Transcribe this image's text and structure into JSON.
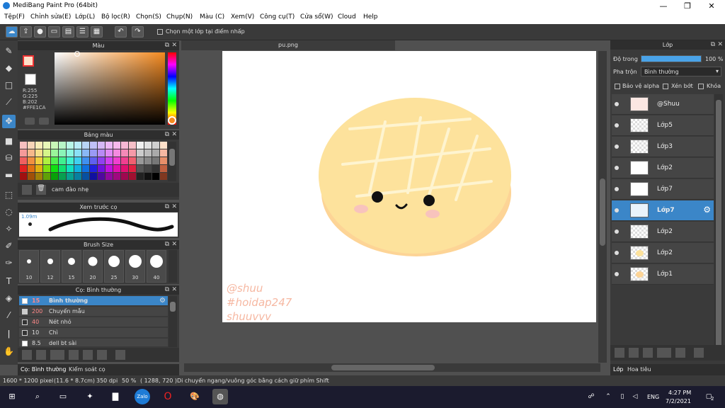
{
  "window": {
    "title": "MediBang Paint Pro (64bit)",
    "minimize": "—",
    "maximize": "❐",
    "close": "✕"
  },
  "menu": [
    "Tệp(F)",
    "Chỉnh sửa(E)",
    "Lớp(L)",
    "Bộ lọc(R)",
    "Chọn(S)",
    "Chụp(N)",
    "Màu (C)",
    "Xem(V)",
    "Công cụ(T)",
    "Cửa sổ(W)",
    "Cloud",
    "Help"
  ],
  "toolbar": {
    "checkbox_label": "Chọn một lớp tại điểm nhấp"
  },
  "color_panel": {
    "title": "Màu",
    "r": "R:255",
    "g": "G:225",
    "b": "B:202",
    "hex": "#FFE1CA",
    "fg": "#ffe1ca"
  },
  "palette_panel": {
    "title": "Bảng màu",
    "palette_name": "cam đào nhẹ"
  },
  "brush_preview": {
    "title": "Xem trước cọ",
    "size_label": "1.09m"
  },
  "brush_size": {
    "title": "Brush Size",
    "sizes": [
      "10",
      "12",
      "15",
      "20",
      "25",
      "30",
      "40"
    ]
  },
  "brush_list": {
    "title": "Cọ: Bình thường",
    "items": [
      {
        "size": "15",
        "name": "Bình thường",
        "color": "#ffffff"
      },
      {
        "size": "200",
        "name": "Chuyển mẫu",
        "color": "#cccccc"
      },
      {
        "size": "40",
        "name": "Nét nhỏ",
        "color": "#333333"
      },
      {
        "size": "10",
        "name": "Chì",
        "color": "#333333"
      },
      {
        "size": "8.5",
        "name": "dell bt sài",
        "color": "#ffffff"
      }
    ]
  },
  "left_tabs": {
    "tab1": "Cọ: Bình thường",
    "tab2": "Kiểm soát cọ"
  },
  "document": {
    "tab": "pu.png",
    "watermark1": "@shuu",
    "watermark2": "#hoidap247",
    "watermark3": "shuuvvv"
  },
  "layer_panel": {
    "title": "Lớp",
    "opacity_label": "Độ trong",
    "opacity_value": "100 %",
    "blend_label": "Pha trộn",
    "blend_value": "Bình thường",
    "protect_alpha": "Bảo vệ alpha",
    "clipping": "Xén bớt",
    "lock": "Khóa",
    "layers": [
      {
        "name": "@Shuu",
        "selected": false
      },
      {
        "name": "Lớp5",
        "selected": false
      },
      {
        "name": "Lớp3",
        "selected": false
      },
      {
        "name": "Lớp2",
        "selected": false
      },
      {
        "name": "Lớp7",
        "selected": false
      },
      {
        "name": "Lớp7",
        "selected": true
      },
      {
        "name": "Lớp2",
        "selected": false
      },
      {
        "name": "Lớp2",
        "selected": false
      },
      {
        "name": "Lớp1",
        "selected": false
      }
    ],
    "tab1": "Lớp",
    "tab2": "Hoa tiêu"
  },
  "statusbar": {
    "size": "1600 * 1200 pixel",
    "dims": "(11.6 * 8.7cm)",
    "dpi": "350 dpi",
    "zoom": "50 %",
    "coords": "( 1288, 720 )",
    "hint": "Di chuyển ngang/vuông góc bằng cách giữ phím Shift"
  },
  "taskbar": {
    "lang": "ENG",
    "time": "4:27 PM",
    "date": "7/2/2021",
    "notif": "2"
  }
}
